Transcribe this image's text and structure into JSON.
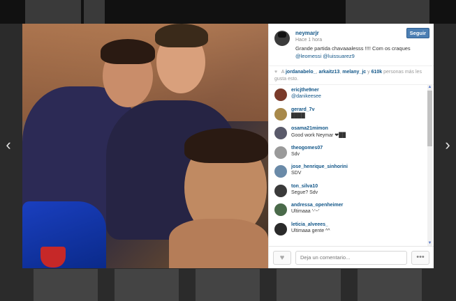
{
  "navigation": {
    "prev_icon": "chevron-left-icon",
    "next_icon": "chevron-right-icon",
    "prev_glyph": "‹",
    "next_glyph": "›"
  },
  "post": {
    "username": "neymarjr",
    "time": "Hace 1 hora",
    "caption_text": "Grande partida chavaaalesss !!!! Com os craques",
    "caption_mentions": "@leomessi @luissuarez9",
    "follow_label": "Seguir",
    "likes": {
      "prefix": "A",
      "users": [
        "jordanabelo_",
        "arkaitz13",
        "melany_jc"
      ],
      "connector": "y",
      "count": "610k",
      "suffix": "personas más les gusta esto."
    }
  },
  "comments": [
    {
      "user": "ericjthe9ner",
      "text": "@danikeesee",
      "text_is_mention": true
    },
    {
      "user": "gerard_7v",
      "text": "████"
    },
    {
      "user": "osama21mimon",
      "text": "Good work Neymar ❤██"
    },
    {
      "user": "theogomes07",
      "text": "Sdv"
    },
    {
      "user": "jose_henrique_sinhorini",
      "text": "SDV"
    },
    {
      "user": "ton_silva10",
      "text": "Segue? Sdv"
    },
    {
      "user": "andressa_openheimer",
      "text": "Ultimaaa '-'~'"
    },
    {
      "user": "leticia_alveees_",
      "text": "Ultimaaa gente ^^"
    }
  ],
  "footer": {
    "comment_placeholder": "Deja un comentario...",
    "like_icon": "heart-icon",
    "more_icon": "more-options-icon",
    "like_glyph": "♥",
    "more_glyph": "•••"
  },
  "colors": {
    "link": "#125688",
    "follow_button": "#4c7fb3"
  }
}
